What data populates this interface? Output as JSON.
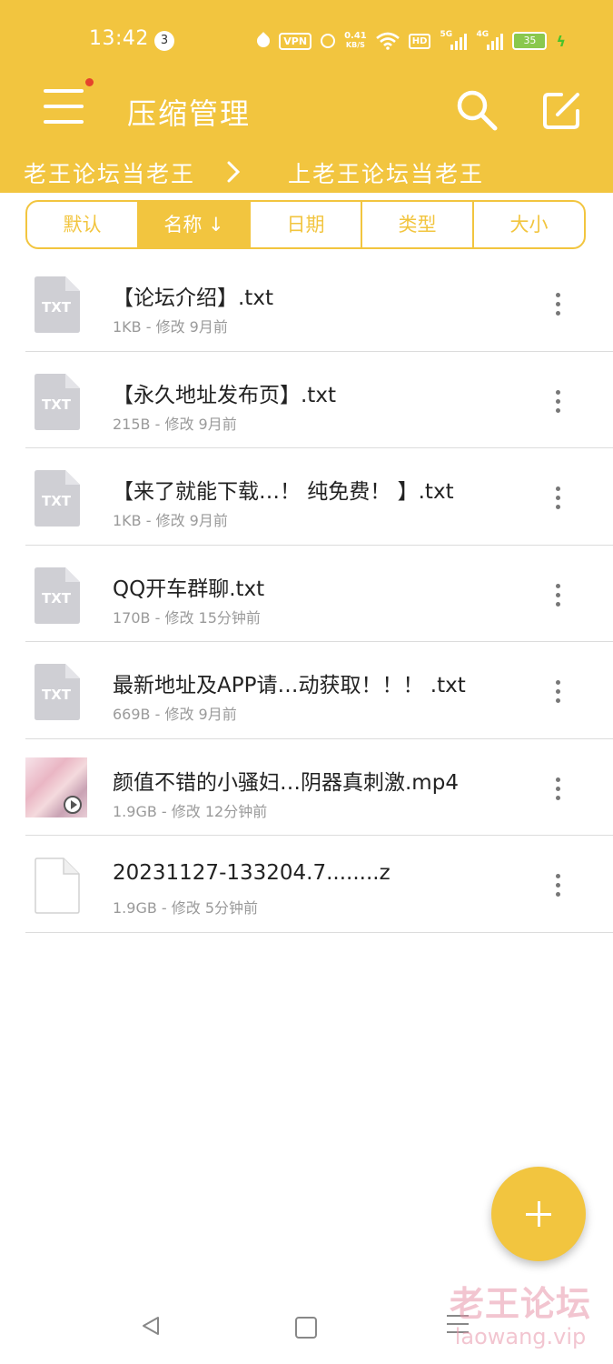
{
  "status_bar": {
    "time": "13:42",
    "notification_count": "3",
    "vpn": "VPN",
    "net_speed_value": "0.41",
    "net_speed_unit": "KB/S",
    "hd": "HD",
    "sig1": "5G",
    "sig2": "4G",
    "battery": "35"
  },
  "header": {
    "title": "压缩管理",
    "breadcrumbs": [
      "老王论坛当老王",
      "上老王论坛当老王"
    ]
  },
  "sort_tabs": [
    {
      "label": "默认",
      "active": false
    },
    {
      "label": "名称 ↓",
      "active": true
    },
    {
      "label": "日期",
      "active": false
    },
    {
      "label": "类型",
      "active": false
    },
    {
      "label": "大小",
      "active": false
    }
  ],
  "files": [
    {
      "name": "【论坛介绍】.txt",
      "meta": "1KB - 修改 9月前",
      "icon": "txt-file-icon",
      "icon_text": "TXT"
    },
    {
      "name": "【永久地址发布页】.txt",
      "meta": "215B - 修改 9月前",
      "icon": "txt-file-icon",
      "icon_text": "TXT"
    },
    {
      "name": "【来了就能下载…！ 纯免费！ 】.txt",
      "meta": "1KB - 修改 9月前",
      "icon": "txt-file-icon",
      "icon_text": "TXT"
    },
    {
      "name": "QQ开车群聊.txt",
      "meta": "170B - 修改 15分钟前",
      "icon": "txt-file-icon",
      "icon_text": "TXT"
    },
    {
      "name": "最新地址及APP请…动获取！！！ .txt",
      "meta": "669B - 修改 9月前",
      "icon": "txt-file-icon",
      "icon_text": "TXT"
    },
    {
      "name": "颜值不错的小骚妇…阴器真刺激.mp4",
      "meta": "1.9GB - 修改 12分钟前",
      "icon": "video-thumbnail"
    },
    {
      "name": "20231127-133204.7........z",
      "meta": "1.9GB - 修改 5分钟前",
      "icon": "generic-file-icon"
    }
  ],
  "watermark": {
    "cn": "老王论坛",
    "en": "laowang.vip"
  },
  "colors": {
    "accent": "#f2c53f",
    "text": "#222222",
    "meta": "#9a9a9a"
  }
}
